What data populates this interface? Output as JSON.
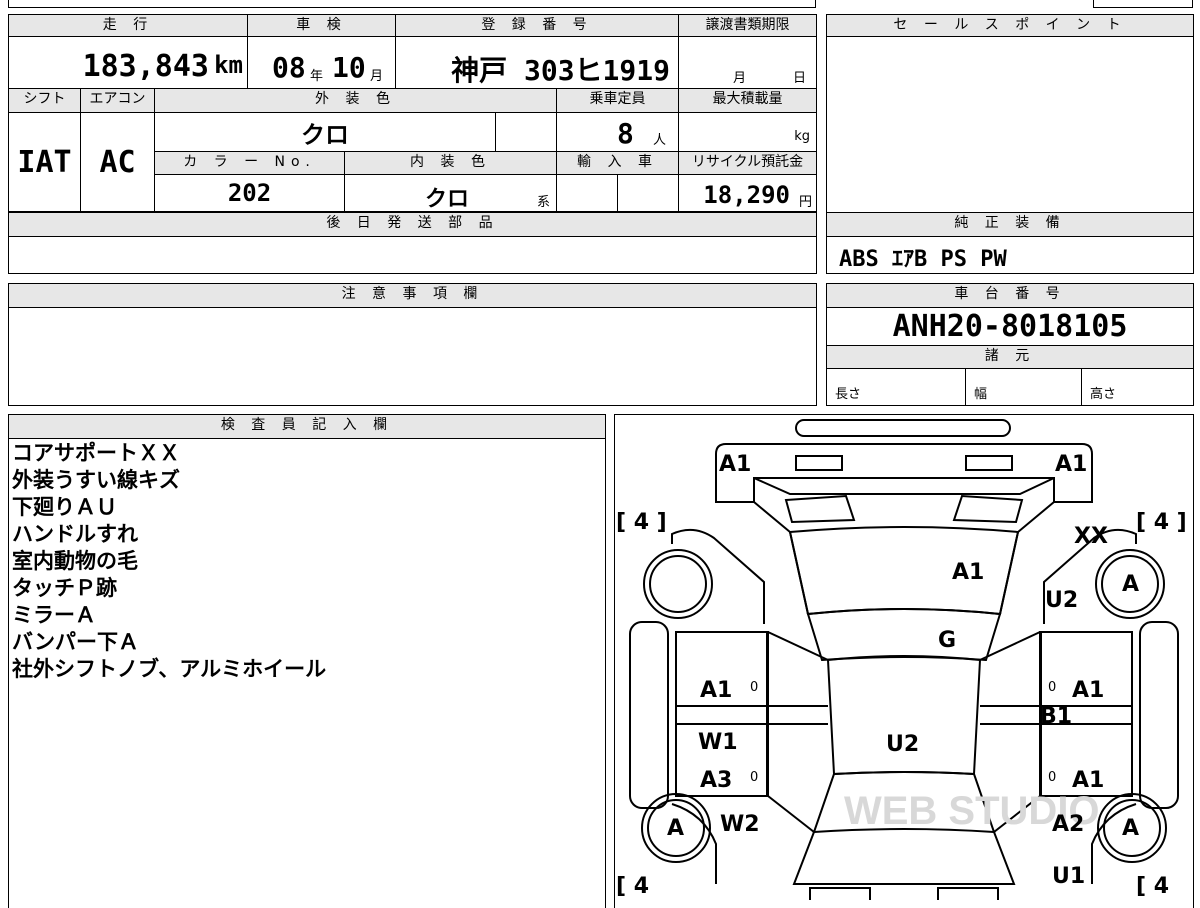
{
  "top_info": {
    "mileage_label": "走 行",
    "mileage_value": "183,843",
    "mileage_unit": "km",
    "shaken_label": "車 検",
    "shaken_year": "08",
    "shaken_year_unit": "年",
    "shaken_month": "10",
    "shaken_month_unit": "月",
    "reg_label": "登 録 番 号",
    "reg_value": "神戸 303ヒ1919",
    "deadline_label": "譲渡書類期限",
    "deadline_month": "月",
    "deadline_day": "日"
  },
  "row2": {
    "shift_label": "シフト",
    "shift_value": "IAT",
    "ac_label": "エアコン",
    "ac_value": "AC",
    "exterior_label": "外 装 色",
    "exterior_value": "クロ",
    "capacity_label": "乗車定員",
    "capacity_value": "8",
    "capacity_unit": "人",
    "maxload_label": "最大積載量",
    "maxload_unit": "kg",
    "color_no_label": "カ ラ ー No.",
    "color_no_value": "202",
    "interior_label": "内 装 色",
    "interior_value": "クロ",
    "interior_suffix": "系",
    "import_label": "輸 入 車",
    "recycle_label": "リサイクル預託金",
    "recycle_value": "18,290",
    "recycle_unit": "円"
  },
  "parts": {
    "label": "後 日 発 送 部 品",
    "value": ""
  },
  "notes": {
    "label": "注 意 事 項 欄",
    "value": ""
  },
  "sales": {
    "label": "セ ー ル ス ポ イ ン ト",
    "value": ""
  },
  "equipment": {
    "label": "純 正 装 備",
    "value": "ABS ｴｱB PS PW"
  },
  "chassis": {
    "label": "車 台 番 号",
    "value": "ANH20-8018105",
    "specs_label": "諸 元",
    "length_label": "長さ",
    "width_label": "幅",
    "height_label": "高さ"
  },
  "inspector": {
    "label": "検 査 員 記 入 欄",
    "lines": [
      "コアサポートＸＸ",
      "外装うすい線キズ",
      "下廻りＡＵ",
      "ハンドルすれ",
      "室内動物の毛",
      "タッチＰ跡",
      "ミラーＡ",
      "バンパー下Ａ",
      "社外シフトノブ、アルミホイール"
    ]
  },
  "diagram": {
    "marks": {
      "front_left": "A1",
      "front_right": "A1",
      "hood_right": "XX",
      "hood": "A1",
      "fender_right": "U2",
      "windshield": "G",
      "front_door_left": "A1",
      "front_door_right": "A1",
      "rocker_right": "B1",
      "roof": "U2",
      "rear_door_left_upper": "W1",
      "rear_door_left": "A3",
      "rear_door_right": "A1",
      "quarter_left": "W2",
      "quarter_right": "A2",
      "rear_right": "U1"
    },
    "tire_front_left": "[ 4 ]",
    "tire_front_right": "[ 4 ]",
    "tire_rear_left": "[ 4",
    "tire_rear_right": "[ 4",
    "wheel_front_right": "A",
    "wheel_rear_left": "A",
    "wheel_rear_right": "A",
    "zero_mark": "0",
    "watermark": "WEB STUDIO"
  }
}
